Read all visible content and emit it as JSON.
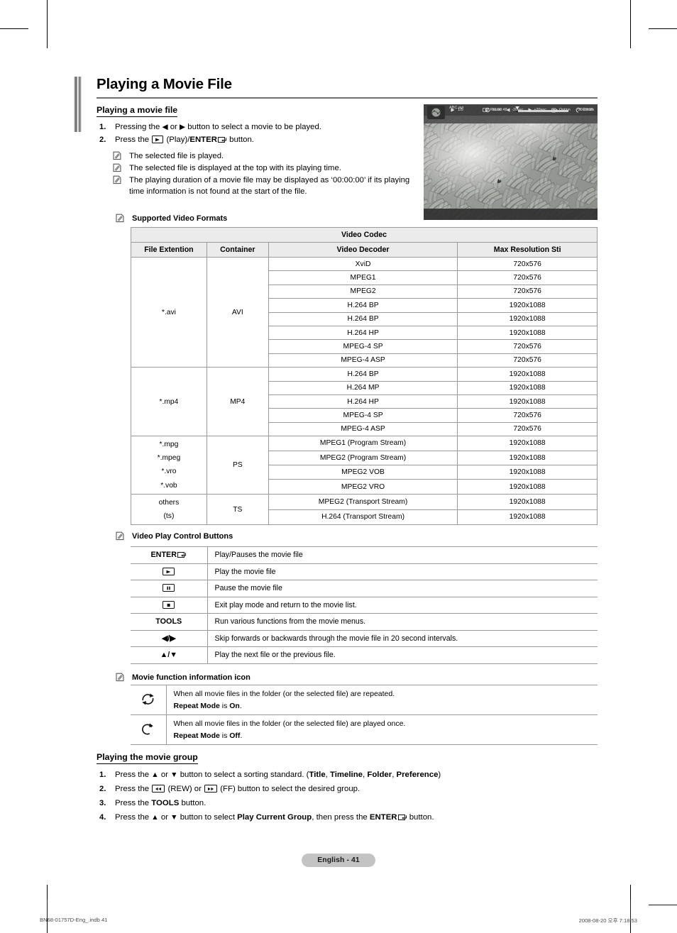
{
  "page_title": "Playing a Movie File",
  "sections": {
    "playing_movie_file": {
      "heading": "Playing a movie file",
      "steps": [
        {
          "num": "1.",
          "pre": "Pressing the ",
          "mid": " or ",
          "post": " button to select a movie to be played."
        },
        {
          "num": "2.",
          "pre": "Press the ",
          "mid": " (Play)/",
          "bold": "ENTER",
          "post": " button."
        }
      ],
      "notes": [
        "The selected file is played.",
        "The selected file is displayed at the top with its playing time.",
        "The playing duration of a movie file may be displayed as ‘00:00:00’ if its playing time information is not found at the start of the file."
      ]
    },
    "supported_video_formats": {
      "label": "Supported Video Formats",
      "table": {
        "group_header": "Video Codec",
        "columns": [
          "File Extention",
          "Container",
          "Video Decoder",
          "Max Resolution Sti"
        ],
        "groups": [
          {
            "extension": "*.avi",
            "container": "AVI",
            "rows": [
              {
                "decoder": "XviD",
                "resolution": "720x576"
              },
              {
                "decoder": "MPEG1",
                "resolution": "720x576"
              },
              {
                "decoder": "MPEG2",
                "resolution": "720x576"
              },
              {
                "decoder": "H.264 BP",
                "resolution": "1920x1088"
              },
              {
                "decoder": "H.264 BP",
                "resolution": "1920x1088"
              },
              {
                "decoder": "H.264 HP",
                "resolution": "1920x1088"
              },
              {
                "decoder": "MPEG-4 SP",
                "resolution": "720x576"
              },
              {
                "decoder": "MPEG-4 ASP",
                "resolution": "720x576"
              }
            ]
          },
          {
            "extension": "*.mp4",
            "container": "MP4",
            "rows": [
              {
                "decoder": "H.264 BP",
                "resolution": "1920x1088"
              },
              {
                "decoder": "H.264 MP",
                "resolution": "1920x1088"
              },
              {
                "decoder": "H.264 HP",
                "resolution": "1920x1088"
              },
              {
                "decoder": "MPEG-4 SP",
                "resolution": "720x576"
              },
              {
                "decoder": "MPEG-4 ASP",
                "resolution": "720x576"
              }
            ]
          },
          {
            "extension": "*.mpg\n*.mpeg\n*.vro\n*.vob",
            "container": "PS",
            "rows": [
              {
                "decoder": "MPEG1 (Program Stream)",
                "resolution": "1920x1088"
              },
              {
                "decoder": "MPEG2 (Program Stream)",
                "resolution": "1920x1088"
              },
              {
                "decoder": "MPEG2 VOB",
                "resolution": "1920x1088"
              },
              {
                "decoder": "MPEG2 VRO",
                "resolution": "1920x1088"
              }
            ]
          },
          {
            "extension": "others\n(ts)",
            "container": "TS",
            "rows": [
              {
                "decoder": "MPEG2 (Transport Stream)",
                "resolution": "1920x1088"
              },
              {
                "decoder": "H.264 (Transport Stream)",
                "resolution": "1920x1088"
              }
            ]
          }
        ]
      }
    },
    "video_play_control_buttons": {
      "label": "Video Play Control Buttons",
      "rows": [
        {
          "key": "ENTER",
          "key_icon": "enter-icon",
          "desc": "Play/Pauses the movie file"
        },
        {
          "key": "",
          "key_icon": "play-icon",
          "desc": "Play the movie file"
        },
        {
          "key": "",
          "key_icon": "pause-icon",
          "desc": "Pause the movie file"
        },
        {
          "key": "",
          "key_icon": "stop-icon",
          "desc": "Exit play mode and return to the movie list."
        },
        {
          "key": "TOOLS",
          "key_icon": "",
          "desc": "Run various functions from the movie menus."
        },
        {
          "key": "◀/▶",
          "key_icon": "left-right-arrow-icon",
          "desc": "Skip forwards or backwards through the movie file in 20 second intervals."
        },
        {
          "key": "▲/▼",
          "key_icon": "up-down-arrow-icon",
          "desc": "Play the next file or the previous file."
        }
      ]
    },
    "movie_function_information_icon": {
      "label": "Movie function information icon",
      "rows": [
        {
          "icon": "repeat-all-icon",
          "line1": "When all movie files in the folder (or the selected file) are repeated.",
          "line2_pre": "Repeat Mode",
          "line2_mid": " is ",
          "line2_bold": "On",
          "line2_post": "."
        },
        {
          "icon": "repeat-once-icon",
          "line1": "When all movie files in the folder (or the selected file) are played once.",
          "line2_pre": "Repeat Mode",
          "line2_mid": " is ",
          "line2_bold": "Off",
          "line2_post": "."
        }
      ]
    },
    "playing_movie_group": {
      "heading": "Playing the movie group",
      "steps": [
        {
          "num": "1.",
          "parts_a": "Press the ",
          "parts_b": " or ",
          "parts_c": " button to select a sorting standard. (",
          "opt1": "Title",
          "opt2": "Timeline",
          "opt3": "Folder",
          "opt4": "Preference",
          "parts_d": ")"
        },
        {
          "num": "2.",
          "parts_a": "Press the ",
          "parts_b": " (REW) or ",
          "parts_c": " (FF) button to select the desired group."
        },
        {
          "num": "3.",
          "parts_a": "Press the ",
          "bold": "TOOLS",
          "parts_b": " button."
        },
        {
          "num": "4.",
          "parts_a": "Press the ",
          "parts_b": " or ",
          "parts_c": " button to select ",
          "bold1": "Play Current Group",
          "parts_d": ", then press the ",
          "bold2": "ENTER",
          "parts_e": " button."
        }
      ]
    }
  },
  "tv_screen": {
    "file_name": "ABC.avi",
    "index": "1/5",
    "elapsed": "00:00:48",
    "total": "00:23:05",
    "source_label": "SUM",
    "keys": [
      {
        "label": "Pause",
        "icon": "enter-icon"
      },
      {
        "label": "-20sec",
        "icon": "left-arrow-icon"
      },
      {
        "label": "+20sec",
        "icon": "right-arrow-icon"
      },
      {
        "label": "Option",
        "icon": "tools-icon"
      },
      {
        "label": "Return",
        "icon": "return-icon"
      }
    ]
  },
  "footer": {
    "page_label": "English - 41",
    "file_ref": "BN68-01757D-Eng_.indb   41",
    "timestamp": "2008-08-20   오후 7:18:53"
  },
  "colors": {
    "rule": "#6e6e6e",
    "table_border": "#9a9a9a",
    "header_fill": "#ebebeb",
    "page_pill": "#c3c3c3"
  }
}
